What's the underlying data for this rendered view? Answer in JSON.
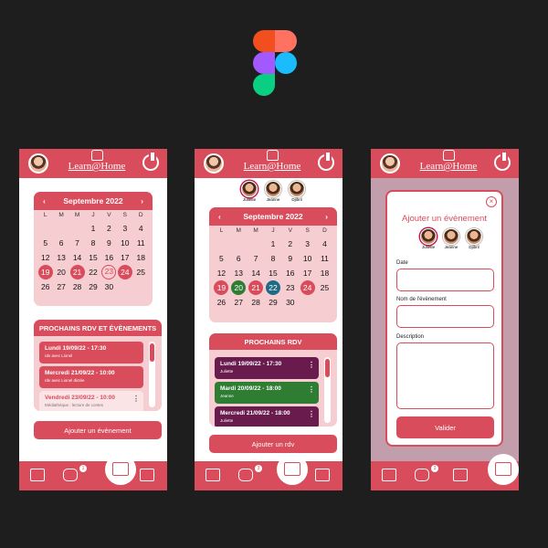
{
  "app": {
    "name": "Learn@Home"
  },
  "calendar": {
    "month_label": "Septembre 2022",
    "prev_icon": "chevron-left",
    "next_icon": "chevron-right",
    "weekdays": [
      "L",
      "M",
      "M",
      "J",
      "V",
      "S",
      "D"
    ],
    "weeks": [
      [
        "",
        "",
        "",
        "1",
        "2",
        "3",
        "4"
      ],
      [
        "5",
        "6",
        "7",
        "8",
        "9",
        "10",
        "11"
      ],
      [
        "12",
        "13",
        "14",
        "15",
        "16",
        "17",
        "18"
      ],
      [
        "19",
        "20",
        "21",
        "22",
        "23",
        "24",
        "25"
      ],
      [
        "26",
        "27",
        "28",
        "29",
        "30",
        "",
        ""
      ]
    ]
  },
  "screen1": {
    "events_title": "PROCHAINS RDV ET ÉVÈNEMENTS",
    "events": [
      {
        "title": "Lundi 19/09/22 - 17:30",
        "subtitle": "rdv avec Lionel"
      },
      {
        "title": "Mercredi 21/09/22 - 10:00",
        "subtitle": "rdv avec Lionel dictée"
      },
      {
        "title": "Vendredi 23/09/22 - 10:00",
        "subtitle": "Médiathèque : lecture de contes"
      }
    ],
    "add_button": "Ajouter un évènement"
  },
  "screen2": {
    "events_title": "PROCHAINS RDV",
    "events": [
      {
        "title": "Lundi 19/09/22 - 17:30",
        "subtitle": "Juliette",
        "color": "#6a1b4d"
      },
      {
        "title": "Mardi 20/09/22 - 18:00",
        "subtitle": "Jeanne",
        "color": "#2e7d32"
      },
      {
        "title": "Mercredi 21/09/22 - 18:00",
        "subtitle": "Juliette",
        "color": "#6a1b4d"
      }
    ],
    "add_button": "Ajouter un rdv"
  },
  "pupils": [
    {
      "name": "Juliette"
    },
    {
      "name": "Jeanne"
    },
    {
      "name": "Djibril"
    }
  ],
  "modal": {
    "title": "Ajouter un évènement",
    "date_label": "Date",
    "event_name_label": "Nom de l'évènement",
    "description_label": "Description",
    "submit": "Valider"
  },
  "nav": {
    "messages_badge": "1",
    "messages_badge_2": "3"
  },
  "colors": {
    "primary": "#d94c5c",
    "light": "#f6cdd0",
    "plum": "#6a1b4d",
    "green": "#2e7d32",
    "teal": "#1f6b86"
  }
}
